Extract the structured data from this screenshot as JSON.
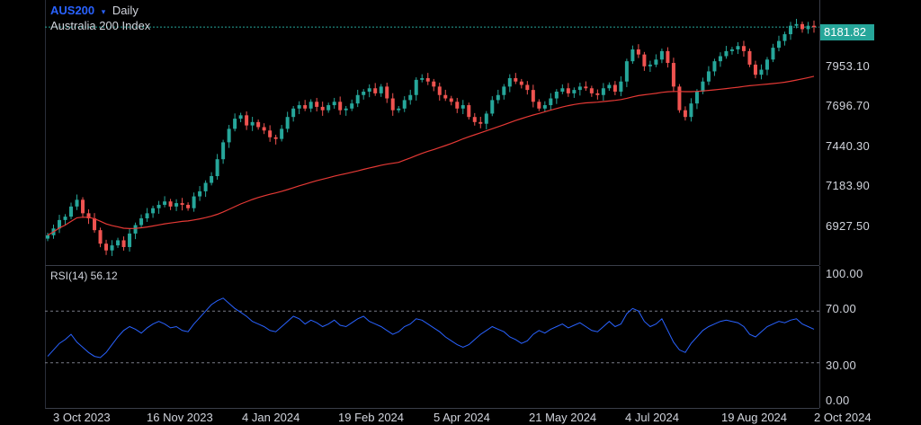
{
  "header": {
    "symbol": "AUS200",
    "indicator_glyph": "▾",
    "timeframe": "Daily",
    "instrument_name": "Australia 200 Index"
  },
  "price_axis": {
    "labels": [
      "7953.10",
      "7696.70",
      "7440.30",
      "7183.90",
      "6927.50"
    ],
    "last_price": "8181.82",
    "colors": {
      "up": "#26a69a",
      "down": "#ef5350",
      "ma": "#e53935",
      "last": "#26a69a"
    }
  },
  "rsi": {
    "title": "RSI(14) 56.12",
    "labels": [
      "100.00",
      "70.00",
      "30.00",
      "0.00"
    ],
    "color": "#2962ff"
  },
  "time_axis": {
    "labels": [
      "3 Oct 2023",
      "16 Nov 2023",
      "4 Jan 2024",
      "19 Feb 2024",
      "5 Apr 2024",
      "21 May 2024",
      "4 Jul 2024",
      "19 Aug 2024",
      "2 Oct 2024"
    ]
  },
  "chart_data": {
    "type": "line",
    "price_close_approx": [
      6950,
      6990,
      7040,
      7060,
      7120,
      7160,
      7080,
      7050,
      6980,
      6900,
      6860,
      6890,
      6920,
      6880,
      6960,
      7010,
      7050,
      7080,
      7110,
      7130,
      7150,
      7120,
      7140,
      7130,
      7110,
      7180,
      7210,
      7260,
      7300,
      7400,
      7500,
      7580,
      7640,
      7660,
      7600,
      7620,
      7590,
      7570,
      7530,
      7520,
      7580,
      7650,
      7700,
      7720,
      7700,
      7740,
      7710,
      7690,
      7720,
      7740,
      7690,
      7700,
      7730,
      7780,
      7800,
      7820,
      7790,
      7830,
      7760,
      7690,
      7700,
      7750,
      7780,
      7870,
      7880,
      7860,
      7830,
      7780,
      7760,
      7740,
      7700,
      7720,
      7650,
      7620,
      7610,
      7670,
      7750,
      7780,
      7830,
      7880,
      7860,
      7840,
      7810,
      7740,
      7700,
      7720,
      7760,
      7800,
      7820,
      7790,
      7810,
      7830,
      7820,
      7790,
      7780,
      7820,
      7840,
      7800,
      7860,
      7980,
      8050,
      8020,
      7950,
      7960,
      7990,
      8040,
      7970,
      7830,
      7690,
      7650,
      7730,
      7800,
      7860,
      7920,
      7980,
      8010,
      8040,
      8050,
      8070,
      8040,
      7960,
      7900,
      7930,
      7990,
      8060,
      8100,
      8140,
      8190,
      8200,
      8170,
      8190,
      8182
    ],
    "rsi_values_approx": [
      35,
      40,
      45,
      48,
      52,
      46,
      42,
      38,
      35,
      34,
      38,
      44,
      50,
      55,
      58,
      56,
      53,
      57,
      60,
      62,
      60,
      57,
      58,
      55,
      54,
      60,
      65,
      70,
      75,
      78,
      80,
      76,
      72,
      69,
      66,
      62,
      60,
      58,
      55,
      54,
      58,
      62,
      66,
      64,
      60,
      63,
      61,
      58,
      60,
      63,
      59,
      58,
      61,
      64,
      66,
      62,
      60,
      58,
      55,
      52,
      54,
      58,
      60,
      64,
      63,
      60,
      57,
      54,
      50,
      47,
      44,
      42,
      44,
      48,
      52,
      55,
      58,
      56,
      54,
      50,
      48,
      45,
      47,
      52,
      55,
      53,
      56,
      58,
      60,
      57,
      59,
      61,
      58,
      55,
      54,
      58,
      62,
      58,
      60,
      68,
      72,
      70,
      62,
      58,
      60,
      64,
      55,
      46,
      40,
      38,
      45,
      50,
      55,
      58,
      60,
      62,
      63,
      62,
      61,
      58,
      52,
      50,
      54,
      58,
      60,
      62,
      61,
      63,
      64,
      60,
      58,
      56
    ],
    "price_ylim": [
      6800,
      8300
    ],
    "rsi_ylim": [
      0,
      100
    ],
    "rsi_levels": [
      70,
      30
    ]
  }
}
